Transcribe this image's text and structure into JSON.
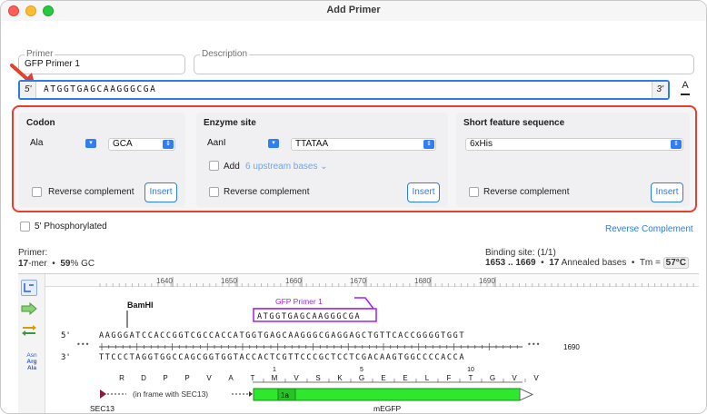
{
  "window": {
    "title": "Add Primer"
  },
  "primer_field": {
    "legend": "Primer",
    "value": "GFP Primer 1"
  },
  "description_field": {
    "legend": "Description",
    "value": ""
  },
  "sequence": {
    "five_prime": "5'",
    "three_prime": "3'",
    "value": "ATGGTGAGCAAGGGCGA"
  },
  "font_button": {
    "label": "A"
  },
  "codon": {
    "title": "Codon",
    "amino_acid": "Ala",
    "codon_value": "GCA",
    "reverse_label": "Reverse complement",
    "insert_label": "Insert"
  },
  "enzyme": {
    "title": "Enzyme site",
    "enzyme_name": "AanI",
    "site": "TTATAA",
    "add_label": "Add",
    "upstream_label": "6 upstream bases",
    "reverse_label": "Reverse complement",
    "insert_label": "Insert"
  },
  "feature": {
    "title": "Short feature sequence",
    "value": "6xHis",
    "reverse_label": "Reverse complement",
    "insert_label": "Insert"
  },
  "phosphorylated_label": "5' Phosphorylated",
  "reverse_complement_link": "Reverse Complement",
  "stats": {
    "primer_label": "Primer:",
    "length": "17",
    "length_unit": "-mer",
    "bullet": "•",
    "gc": "59",
    "gc_unit": "% GC",
    "binding_label": "Binding site: (1/1)",
    "binding_range": "1653 .. 1669",
    "annealed_count": "17",
    "annealed_label": "Annealed bases",
    "tm_label": "Tm =",
    "tm_value": "57°C"
  },
  "map": {
    "ruler_ticks": [
      "1640",
      "1650",
      "1660",
      "1670",
      "1680",
      "1690"
    ],
    "enzyme_label": "BamHI",
    "primer_label": "GFP Primer 1",
    "primer_seq": "ATGGTGAGCAAGGGCGA",
    "top_prefix": "5'",
    "bottom_prefix": "3'",
    "dots": "•••",
    "top_strand": "AAGGGATCCACCGGTCGCCACCATGGTGAGCAAGGGCGAGGAGCTGTTCACCGGGGTGGT",
    "bottom_strand": "TTCCCTAGGTGGCCAGCGGTGGTACCACTCGTTCCCGCTCCTCGACAAGTGGCCCCACCA",
    "end_position": "1690",
    "translation": [
      "R",
      "D",
      "P",
      "P",
      "V",
      "A",
      "T",
      "M",
      "V",
      "S",
      "K",
      "G",
      "E",
      "E",
      "L",
      "F",
      "T",
      "G",
      "V",
      "V"
    ],
    "aa_numbers": [
      "1",
      "5",
      "10"
    ],
    "sec13_label": "SEC13",
    "in_frame_label": "(in frame with SEC13)",
    "exon_label": "1a",
    "feature_label": "mEGFP",
    "tools": {
      "aa_line1": "Asn",
      "aa_line2": "Arg",
      "aa_line3": "Ala"
    },
    "colors": {
      "feature_green": "#2ee82e",
      "primer_purple": "#a020f0",
      "highlight_red": "#e5402e",
      "accent_blue": "#2b7de9"
    }
  }
}
